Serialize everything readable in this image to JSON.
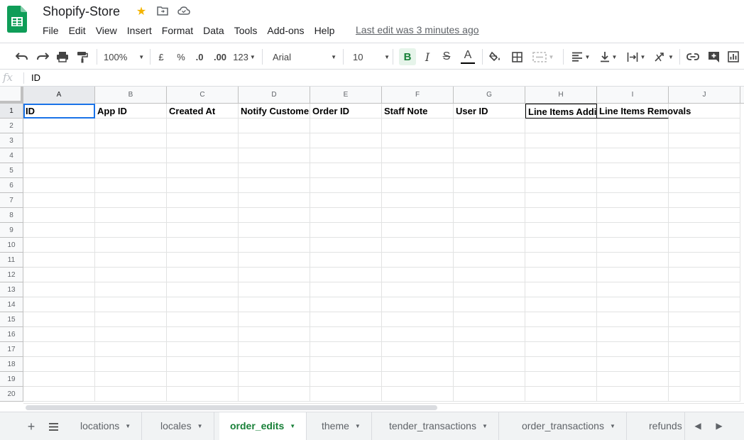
{
  "app": {
    "title": "Shopify-Store",
    "last_edit": "Last edit was 3 minutes ago",
    "brand_color": "#0f9d58"
  },
  "menu": [
    "File",
    "Edit",
    "View",
    "Insert",
    "Format",
    "Data",
    "Tools",
    "Add-ons",
    "Help"
  ],
  "toolbar": {
    "zoom": "100%",
    "currency": "£",
    "percent": "%",
    "decrease_decimal": ".0",
    "increase_decimal": ".00",
    "number_format": "123",
    "font": "Arial",
    "font_size": "10",
    "bold": "B",
    "italic": "I",
    "strike": "S",
    "text_color": "A"
  },
  "formula_bar": {
    "fx": "fx",
    "value": "ID"
  },
  "grid": {
    "columns": [
      "A",
      "B",
      "C",
      "D",
      "E",
      "F",
      "G",
      "H",
      "I",
      "J"
    ],
    "rows": [
      "1",
      "2",
      "3",
      "4",
      "5",
      "6",
      "7",
      "8",
      "9",
      "10",
      "11",
      "12",
      "13",
      "14",
      "15",
      "16",
      "17",
      "18",
      "19",
      "20"
    ],
    "header_cells": [
      "ID",
      "App ID",
      "Created At",
      "Notify Customer",
      "Order ID",
      "Staff Note",
      "User ID",
      "Line Items Additions",
      "Line Items Removals",
      ""
    ]
  },
  "sheets": {
    "tabs": [
      "locations",
      "locales",
      "order_edits",
      "theme",
      "tender_transactions",
      "order_transactions",
      "refunds"
    ],
    "active": "order_edits",
    "active_color": "#188038"
  }
}
